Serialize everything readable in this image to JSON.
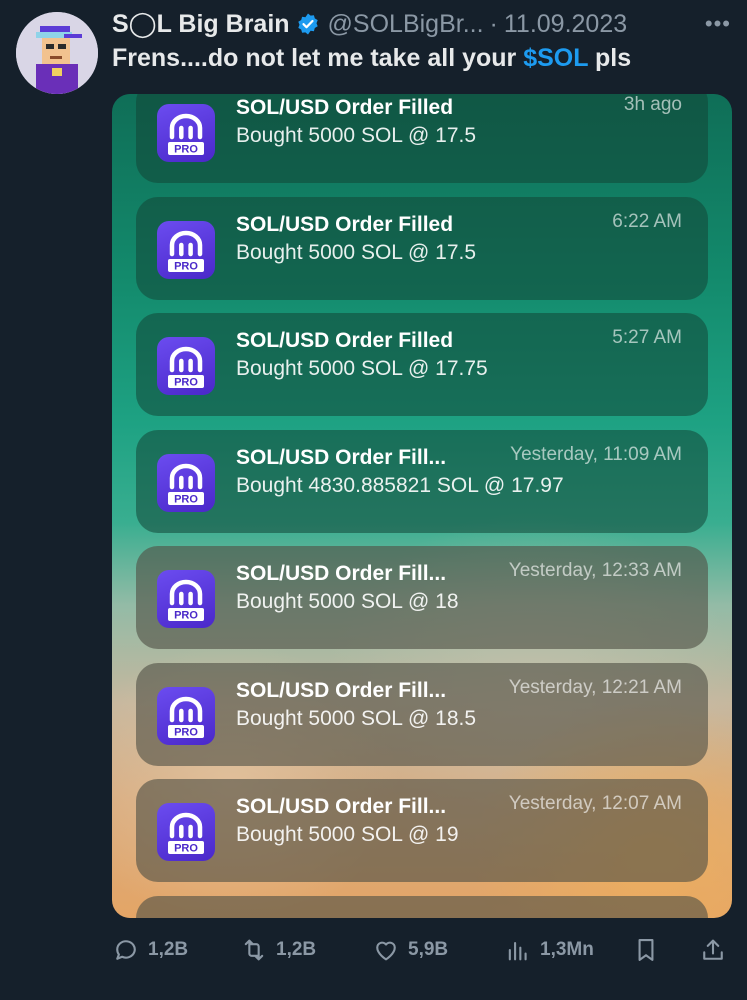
{
  "tweet": {
    "display_name": "S◯L Big Brain",
    "handle": "@SOLBigBr...",
    "separator": "·",
    "date": "11.09.2023",
    "more_label": "•••",
    "text_before": "Frens....do not let me take all your ",
    "cashtag": "$SOL",
    "text_after": " pls"
  },
  "notifications": [
    {
      "title": "SOL/USD Order Filled",
      "time": "3h ago",
      "body": "Bought 5000 SOL @ 17.5"
    },
    {
      "title": "SOL/USD Order Filled",
      "time": "6:22 AM",
      "body": "Bought 5000 SOL @ 17.5"
    },
    {
      "title": "SOL/USD Order Filled",
      "time": "5:27 AM",
      "body": "Bought 5000 SOL @ 17.75"
    },
    {
      "title": "SOL/USD Order Fill...",
      "time": "Yesterday, 11:09 AM",
      "body": "Bought 4830.885821 SOL @ 17.97"
    },
    {
      "title": "SOL/USD Order Fill...",
      "time": "Yesterday, 12:33 AM",
      "body": "Bought 5000 SOL @ 18"
    },
    {
      "title": "SOL/USD Order Fill...",
      "time": "Yesterday, 12:21 AM",
      "body": "Bought 5000 SOL @ 18.5"
    },
    {
      "title": "SOL/USD Order Fill...",
      "time": "Yesterday, 12:07 AM",
      "body": "Bought 5000 SOL @ 19"
    }
  ],
  "app_icon_label": "PRO",
  "actions": {
    "replies": "1,2B",
    "reposts": "1,2B",
    "likes": "5,9B",
    "views": "1,3Mn"
  },
  "colors": {
    "background": "#15202b",
    "accent": "#1d9bf0",
    "muted": "#8b98a5",
    "app_icon": "#5a36dc"
  }
}
